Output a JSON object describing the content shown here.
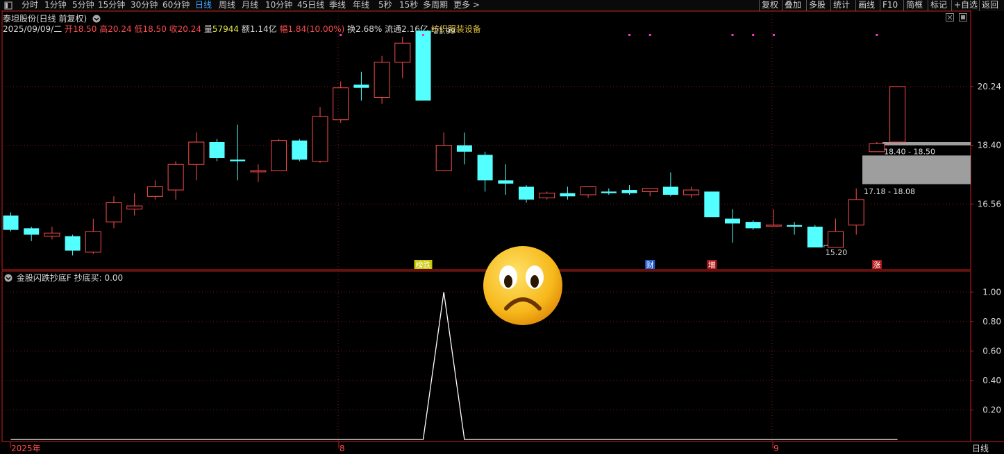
{
  "toolbar": {
    "left_icon": "panel-icon",
    "tabs": [
      "分时",
      "1分钟",
      "5分钟",
      "15分钟",
      "30分钟",
      "60分钟",
      "日线",
      "周线",
      "月线",
      "10分钟",
      "45日线",
      "季线",
      "年线",
      "5秒",
      "15秒",
      "多周期",
      "更多 >"
    ],
    "active_tab": "日线",
    "right_tabs": [
      "复权",
      "叠加",
      "多股",
      "统计",
      "画线",
      "F10",
      "简框",
      "标记",
      "+自选",
      "返回"
    ]
  },
  "header": {
    "stock_name": "泰坦股份(日线 前复权)",
    "date": "2025/09/09/二",
    "open_label": "开",
    "open": "18.50",
    "high_label": "高",
    "high": "20.24",
    "low_label": "低",
    "low": "18.50",
    "close_label": "收",
    "close": "20.24",
    "volume_label": "量",
    "volume": "57944",
    "amount_label": "额",
    "amount": "1.14亿",
    "change_label": "幅",
    "change": "1.84(10.00%)",
    "turnover_label": "换",
    "turnover": "2.68%",
    "float_label": "流通",
    "float": "2.16亿",
    "industry": "纺织服装设备"
  },
  "indicator": {
    "title": "金股闪跌抄底F",
    "value_label": "抄底买:",
    "value": "0.00"
  },
  "period_label": "日线",
  "colors": {
    "up": "#ff4d4d",
    "down": "#54ffff",
    "grid": "#7a1a1a",
    "axis": "#c8221e",
    "indicator_line": "#ffffff",
    "marker_dot": "#ff33cc",
    "zone_fill": "#9e9e9e"
  },
  "icons": [
    "chevron-down-icon",
    "sad-face-emoji",
    "close-icon",
    "settings-icon"
  ],
  "chart_data": [
    {
      "type": "candlestick",
      "ylim": [
        14.7,
        22.3
      ],
      "yticks": [
        "16.56",
        "18.40",
        "20.24"
      ],
      "x_labels": [
        {
          "index": 0,
          "text": "2025年"
        },
        {
          "index": 16,
          "text": "8"
        },
        {
          "index": 37,
          "text": "9"
        }
      ],
      "candles": [
        [
          16.2,
          15.75,
          16.3,
          15.7
        ],
        [
          15.8,
          15.6,
          15.85,
          15.4
        ],
        [
          15.55,
          15.65,
          15.85,
          15.45
        ],
        [
          15.55,
          15.1,
          15.6,
          14.95
        ],
        [
          15.05,
          15.7,
          16.1,
          15.0
        ],
        [
          16.0,
          16.6,
          16.8,
          15.8
        ],
        [
          16.4,
          16.5,
          16.9,
          16.2
        ],
        [
          16.8,
          17.1,
          17.3,
          16.7
        ],
        [
          17.0,
          17.8,
          17.9,
          16.7
        ],
        [
          17.8,
          18.5,
          18.8,
          17.3
        ],
        [
          18.5,
          18.0,
          18.6,
          17.9
        ],
        [
          17.95,
          17.9,
          19.05,
          17.3
        ],
        [
          17.6,
          17.6,
          17.8,
          17.25
        ],
        [
          17.6,
          18.55,
          18.6,
          17.6
        ],
        [
          18.55,
          17.95,
          18.6,
          17.9
        ],
        [
          17.9,
          19.3,
          19.6,
          17.85
        ],
        [
          19.2,
          20.2,
          20.4,
          19.1
        ],
        [
          20.3,
          20.2,
          20.7,
          19.8
        ],
        [
          19.9,
          21.0,
          21.2,
          19.7
        ],
        [
          21.0,
          21.6,
          21.8,
          20.5
        ],
        [
          21.99,
          19.8,
          21.99,
          19.8
        ],
        [
          17.6,
          18.4,
          18.8,
          17.6
        ],
        [
          18.4,
          18.2,
          18.8,
          17.8
        ],
        [
          18.1,
          17.3,
          18.2,
          16.95
        ],
        [
          17.3,
          17.2,
          17.8,
          16.85
        ],
        [
          17.1,
          16.7,
          17.15,
          16.6
        ],
        [
          16.75,
          16.9,
          16.95,
          16.7
        ],
        [
          16.9,
          16.8,
          17.1,
          16.7
        ],
        [
          16.85,
          17.1,
          17.1,
          16.75
        ],
        [
          16.95,
          16.9,
          17.05,
          16.85
        ],
        [
          17.0,
          16.9,
          17.15,
          16.85
        ],
        [
          16.95,
          17.05,
          17.05,
          16.8
        ],
        [
          17.1,
          16.85,
          17.55,
          16.8
        ],
        [
          16.85,
          17.0,
          17.1,
          16.75
        ],
        [
          16.95,
          16.15,
          16.95,
          16.15
        ],
        [
          16.1,
          15.95,
          16.4,
          15.35
        ],
        [
          16.0,
          15.8,
          16.05,
          15.75
        ],
        [
          15.9,
          15.9,
          16.4,
          15.9
        ],
        [
          15.9,
          15.85,
          16.0,
          15.6
        ],
        [
          15.85,
          15.2,
          15.9,
          15.2
        ],
        [
          15.2,
          15.7,
          16.1,
          15.2
        ],
        [
          15.9,
          16.7,
          17.05,
          15.6
        ],
        [
          18.2,
          18.45,
          18.5,
          18.2
        ],
        [
          18.5,
          20.24,
          20.24,
          18.5
        ]
      ],
      "annotations": [
        {
          "index": 20,
          "text": "21.99"
        },
        {
          "index": 39,
          "text": "15.20"
        }
      ],
      "zones": [
        {
          "low": 18.4,
          "high": 18.5,
          "label": "18.40 - 18.50"
        },
        {
          "low": 17.18,
          "high": 18.08,
          "label": "17.18 - 18.08"
        }
      ],
      "event_tags": [
        {
          "index": 20,
          "text": "榜跌"
        },
        {
          "index": 31,
          "text": "财"
        },
        {
          "index": 34,
          "text": "增"
        },
        {
          "index": 42,
          "text": "涨"
        }
      ],
      "marker_indices": [
        16,
        20,
        30,
        31,
        35,
        36,
        37,
        42
      ]
    },
    {
      "type": "line",
      "title": "金股闪跌抄底F",
      "ylim": [
        0,
        1.1
      ],
      "yticks": [
        "0.20",
        "0.40",
        "0.60",
        "0.80",
        "1.00"
      ],
      "series": [
        {
          "name": "抄底买",
          "values": [
            0,
            0,
            0,
            0,
            0,
            0,
            0,
            0,
            0,
            0,
            0,
            0,
            0,
            0,
            0,
            0,
            0,
            0,
            0,
            0,
            0,
            1,
            0,
            0,
            0,
            0,
            0,
            0,
            0,
            0,
            0,
            0,
            0,
            0,
            0,
            0,
            0,
            0,
            0,
            0,
            0,
            0,
            0,
            0
          ]
        }
      ]
    }
  ]
}
